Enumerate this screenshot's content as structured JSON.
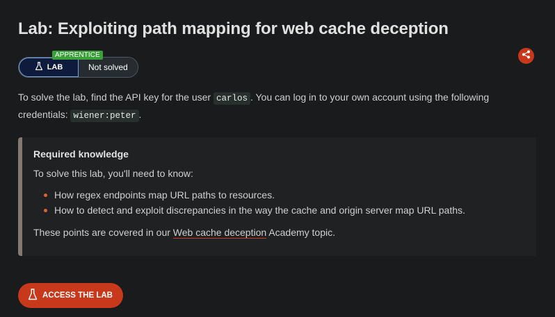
{
  "title": "Lab: Exploiting path mapping for web cache deception",
  "status": {
    "level": "APPRENTICE",
    "lab_label": "LAB",
    "solved_text": "Not solved"
  },
  "share": {
    "icon": "share-icon"
  },
  "intro": {
    "text_before": "To solve the lab, find the API key for the user ",
    "user_code": "carlos",
    "text_middle": ". You can log in to your own account using the following credentials: ",
    "credentials_code": "wiener:peter",
    "text_after": "."
  },
  "knowledge": {
    "heading": "Required knowledge",
    "lead": "To solve this lab, you'll need to know:",
    "items": [
      "How regex endpoints map URL paths to resources.",
      "How to detect and exploit discrepancies in the way the cache and origin server map URL paths."
    ],
    "footer_before": "These points are covered in our ",
    "footer_link": "Web cache deception",
    "footer_after": " Academy topic."
  },
  "access_button": {
    "label": "ACCESS THE LAB",
    "icon": "flask-icon"
  },
  "colors": {
    "accent": "#c8381b",
    "apprentice_badge": "#3aa13a",
    "lab_pill_bg": "#0f1b3d",
    "background": "#1a1b1c"
  }
}
